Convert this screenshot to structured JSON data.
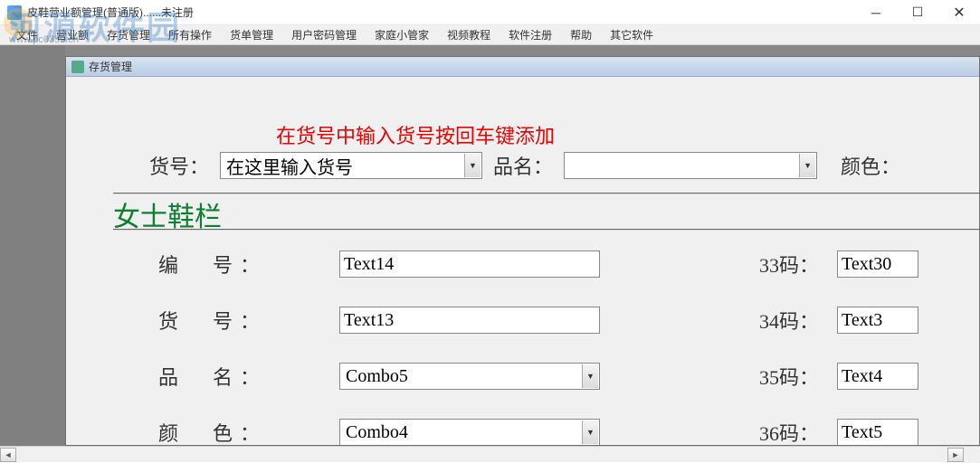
{
  "watermark": {
    "text": "河源软件园",
    "url": "www.pc0359.cn"
  },
  "window": {
    "title": "皮鞋营业额管理(普通版)......未注册"
  },
  "menu": {
    "items": [
      "文件",
      "营业额",
      "存货管理",
      "所有操作",
      "货单管理",
      "用户密码管理",
      "家庭小管家",
      "视频教程",
      "软件注册",
      "帮助",
      "其它软件"
    ]
  },
  "child": {
    "title": "存货管理"
  },
  "instruction": "在货号中输入货号按回车键添加",
  "top_row": {
    "huohao_label": "货号：",
    "huohao_value": "在这里输入货号",
    "pinming_label": "品名：",
    "pinming_value": "",
    "yanse_label": "颜色："
  },
  "section_title": "女士鞋栏",
  "rows": [
    {
      "left_label": "编　号：",
      "left_value": "Text14",
      "right_label": "33码：",
      "right_value": "Text30"
    },
    {
      "left_label": "货　号：",
      "left_value": "Text13",
      "right_label": "34码：",
      "right_value": "Text3"
    },
    {
      "left_label": "品　名：",
      "left_value": "Combo5",
      "right_label": "35码：",
      "right_value": "Text4",
      "combo": true
    },
    {
      "left_label": "颜　色：",
      "left_value": "Combo4",
      "right_label": "36码：",
      "right_value": "Text5",
      "combo": true
    }
  ]
}
